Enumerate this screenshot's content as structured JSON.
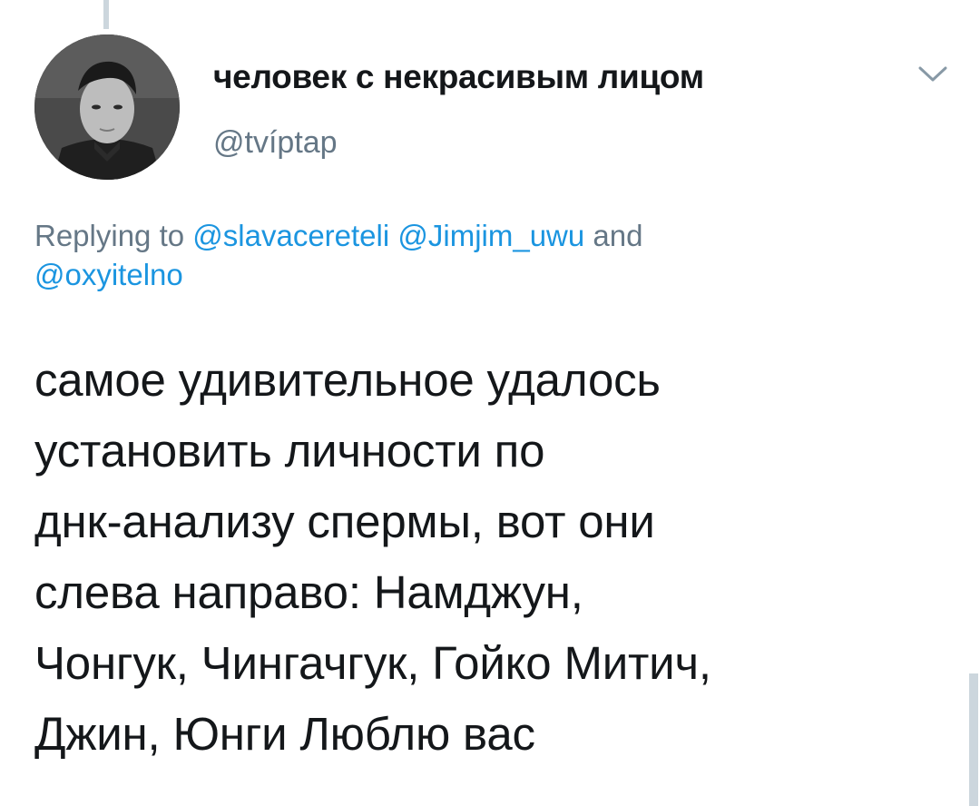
{
  "author": {
    "display_name": "человек с некрасивым лицом",
    "handle": "@tvíptap"
  },
  "reply": {
    "prefix": "Replying to",
    "mentions": [
      "@slavacereteli",
      "@Jimjim_uwu",
      "@oxyitelno"
    ],
    "conjunction": "and"
  },
  "tweet": {
    "lines": [
      "самое удивительное удалось",
      "установить личности по",
      "днк-анализу спермы, вот они",
      "слева направо: Намджун,",
      "Чонгук, Чингачгук, Гойко Митич,",
      "Джин, Юнги Люблю вас"
    ]
  },
  "icons": {
    "caret": "chevron-down-icon"
  },
  "colors": {
    "text": "#14171a",
    "secondary": "#657786",
    "link": "#1b95e0",
    "divider": "#ccd6dd"
  }
}
